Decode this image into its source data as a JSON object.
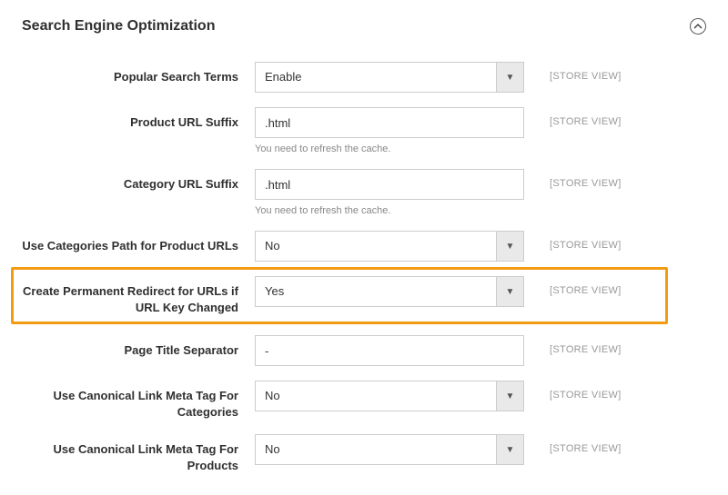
{
  "section": {
    "title": "Search Engine Optimization"
  },
  "scope_label": "[STORE VIEW]",
  "fields": {
    "popular_search_terms": {
      "label": "Popular Search Terms",
      "value": "Enable",
      "type": "select"
    },
    "product_url_suffix": {
      "label": "Product URL Suffix",
      "value": ".html",
      "type": "text",
      "hint": "You need to refresh the cache."
    },
    "category_url_suffix": {
      "label": "Category URL Suffix",
      "value": ".html",
      "type": "text",
      "hint": "You need to refresh the cache."
    },
    "use_cat_path": {
      "label": "Use Categories Path for Product URLs",
      "value": "No",
      "type": "select"
    },
    "perm_redirect": {
      "label": "Create Permanent Redirect for URLs if URL Key Changed",
      "value": "Yes",
      "type": "select"
    },
    "title_sep": {
      "label": "Page Title Separator",
      "value": "-",
      "type": "text"
    },
    "canon_cat": {
      "label": "Use Canonical Link Meta Tag For Categories",
      "value": "No",
      "type": "select"
    },
    "canon_prod": {
      "label": "Use Canonical Link Meta Tag For Products",
      "value": "No",
      "type": "select"
    }
  }
}
